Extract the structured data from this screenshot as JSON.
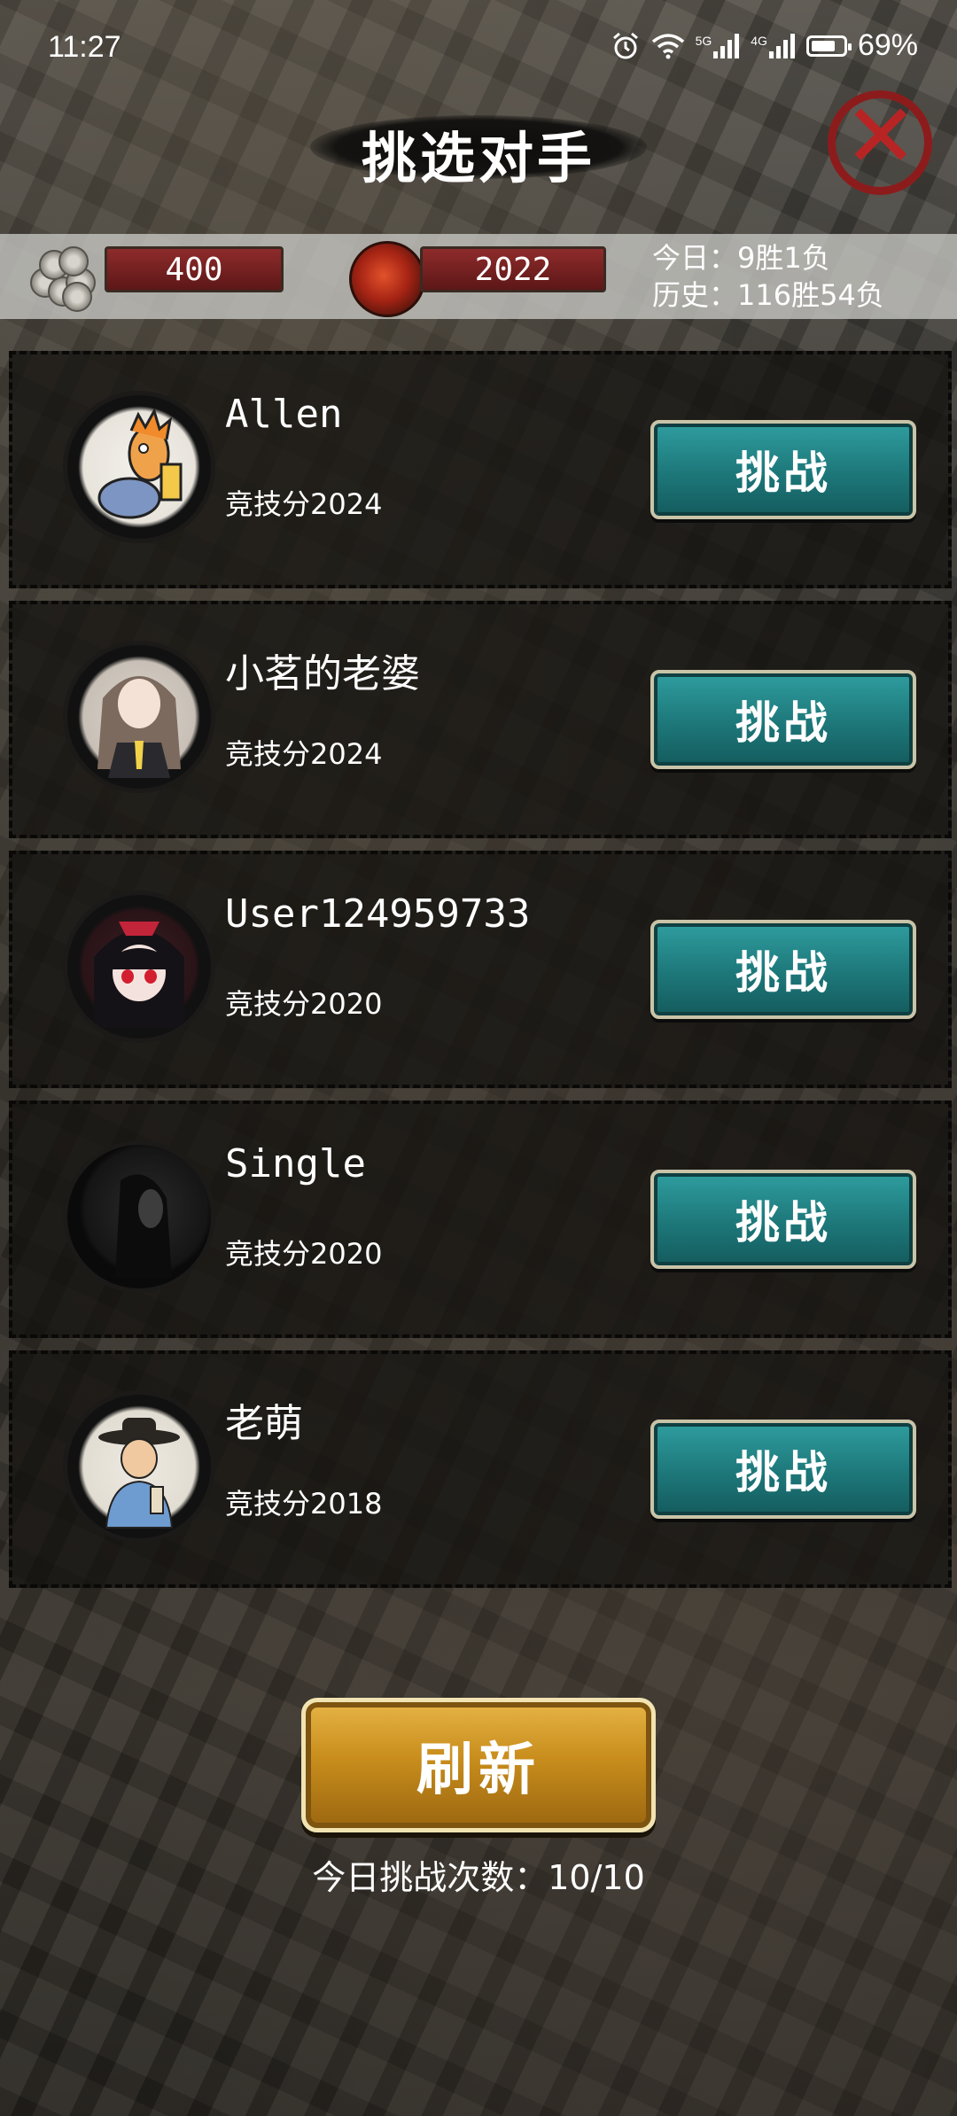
{
  "status_bar": {
    "time": "11:27",
    "network_5g": "5G",
    "network_4g": "4G",
    "battery": "69%",
    "icons": [
      "alarm-icon",
      "wifi-icon",
      "signal-5g-icon",
      "signal-4g-icon",
      "battery-icon"
    ]
  },
  "header": {
    "title": "挑选对手",
    "close_icon": "close-x-icon"
  },
  "resources": {
    "coins": "400",
    "dragon_points": "2022",
    "today_record": "今日：9胜1负",
    "history_record": "历史：116胜54负"
  },
  "opponents": [
    {
      "name": "Allen",
      "score": "竞技分2024",
      "button": "挑战",
      "avatar_color": "#f2f0ea"
    },
    {
      "name": "小茗的老婆",
      "score": "竞技分2024",
      "button": "挑战",
      "avatar_color": "#d9d3cc"
    },
    {
      "name": "User124959733",
      "score": "竞技分2020",
      "button": "挑战",
      "avatar_color": "#3a1e22"
    },
    {
      "name": "Single",
      "score": "竞技分2020",
      "button": "挑战",
      "avatar_color": "#1a1a1a"
    },
    {
      "name": "老萌",
      "score": "竞技分2018",
      "button": "挑战",
      "avatar_color": "#eeeae2"
    }
  ],
  "footer": {
    "refresh": "刷新",
    "attempts": "今日挑战次数：10/10"
  },
  "colors": {
    "challenge_button": "#1d7779",
    "refresh_button": "#c88d1c",
    "resource_pill": "#8e2b2b",
    "close_icon": "#b82424"
  }
}
